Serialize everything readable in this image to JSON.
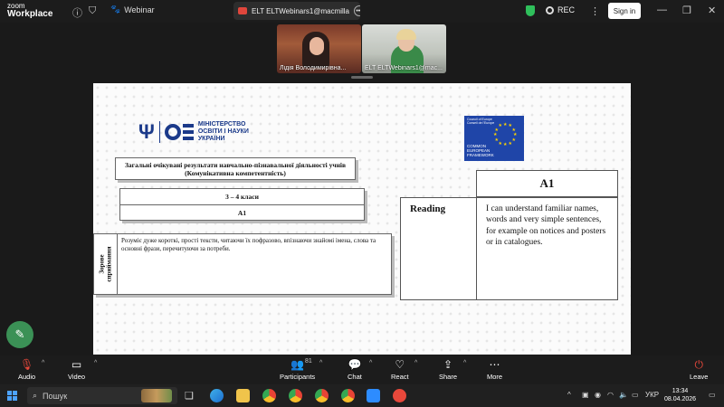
{
  "app": {
    "logo_line1": "zoom",
    "logo_line2": "Workplace",
    "webinar_label": "Webinar",
    "meeting_title": "ELT ELTWebinars1@macmilla",
    "rec_label": "REC",
    "signin_label": "Sign in"
  },
  "participants": [
    {
      "name": "Лідія Володимирівна..."
    },
    {
      "name": "ELT ELTWebinars1@mac..."
    }
  ],
  "slide": {
    "ministry_text": [
      "МІНІСТЕРСТВО",
      "ОСВІТИ І НАУКИ",
      "УКРАЇНИ"
    ],
    "cefr_logo": {
      "coe_text": [
        "Council of Europe",
        "Conseil de l'Europe"
      ],
      "caption": [
        "COMMON",
        "EUROPEAN",
        "FRAMEWORK"
      ]
    },
    "outcomes_title_1": "Загальні очікувані результати навчально-пізнавальної діяльності учнів",
    "outcomes_title_2": "(Комунікативна компетентність)",
    "grade": "3 – 4 класи",
    "level": "А1",
    "skill_ua_1": "Зорове",
    "skill_ua_2": "сприймання",
    "descriptor_ua": "Розуміє дуже короткі, прості тексти, читаючи їх пофразово, впізнаючи знайомі імена, слова та основні фрази, перечитуючи за потреби.",
    "cefr_level": "A1",
    "cefr_skill": "Reading",
    "cefr_descriptor": "I can understand familiar names, words and very simple sentences, for example on notices and posters or in catalogues."
  },
  "toolbar": {
    "audio": "Audio",
    "video": "Video",
    "participants": "Participants",
    "participants_count": "81",
    "chat": "Chat",
    "react": "React",
    "share": "Share",
    "more": "More",
    "leave": "Leave"
  },
  "taskbar": {
    "search_placeholder": "Пошук",
    "language": "УКР",
    "time": "13:34",
    "date": "08.04.2026"
  }
}
